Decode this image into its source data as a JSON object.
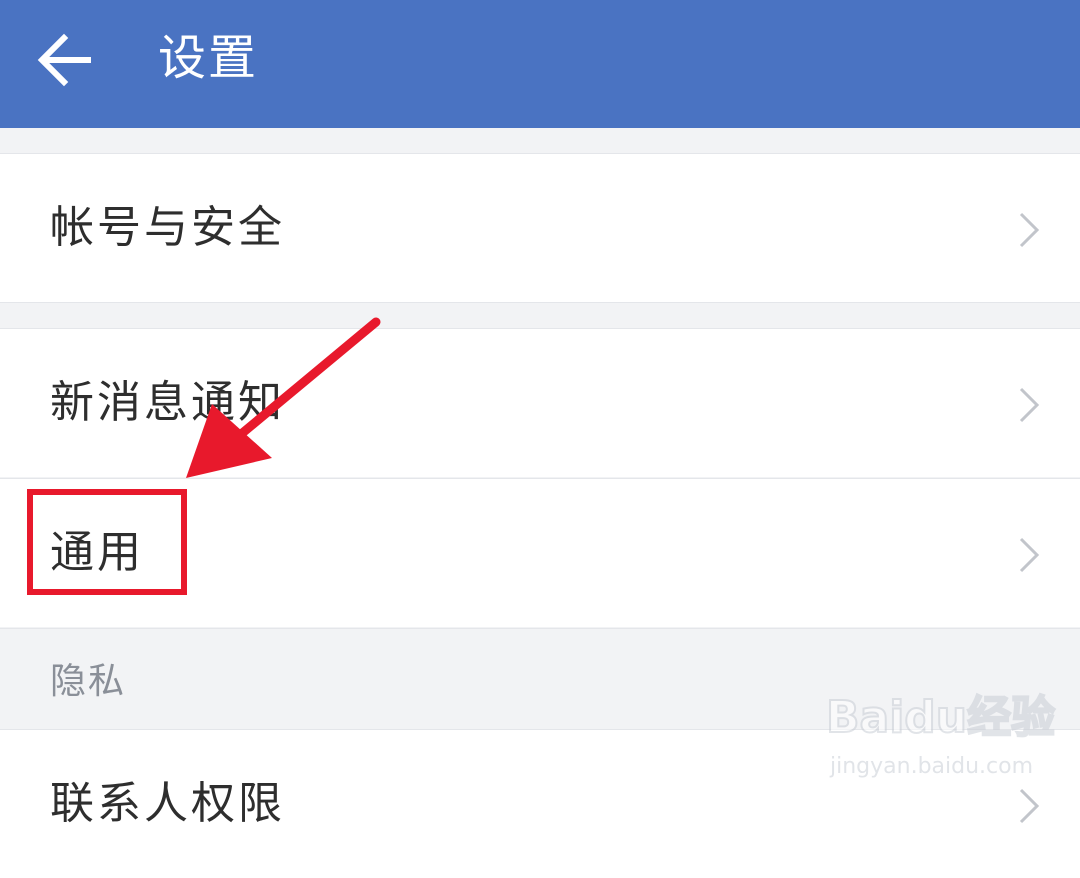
{
  "header": {
    "title": "设置"
  },
  "rows": [
    {
      "label": "帐号与安全"
    },
    {
      "label": "新消息通知"
    },
    {
      "label": "通用"
    }
  ],
  "section_privacy": {
    "label": "隐私",
    "items": [
      {
        "label": "联系人权限"
      }
    ]
  },
  "watermark": {
    "logo": "Baidu经验",
    "url": "jingyan.baidu.com"
  },
  "colors": {
    "header_bg": "#4a73c2",
    "annotation_red": "#e8192c",
    "page_bg": "#f2f3f5"
  },
  "icons": {
    "back": "arrow-left-icon",
    "chevron": "chevron-right-icon"
  }
}
